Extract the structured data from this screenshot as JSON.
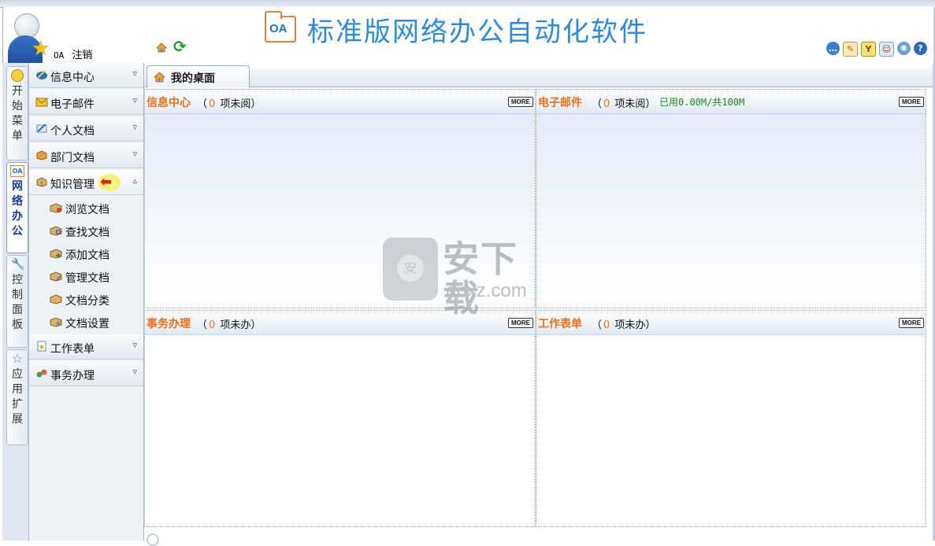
{
  "header": {
    "title": "标准版网络办公自动化软件",
    "logo_text": "OA",
    "user": {
      "name": "OA",
      "logout_label": "注销"
    },
    "right_icons": [
      "chat-icon",
      "edit-icon",
      "yen-icon",
      "contacts-icon",
      "settings-icon",
      "help-icon"
    ]
  },
  "vertical_tabs": [
    {
      "label": "开始菜单",
      "icon": "bulb-icon"
    },
    {
      "label": "网络办公",
      "icon": "oa-icon",
      "active": true
    },
    {
      "label": "控制面板",
      "icon": "wrench-icon"
    },
    {
      "label": "应用扩展",
      "icon": "star-icon"
    }
  ],
  "sidebar": {
    "menus": [
      {
        "label": "信息中心",
        "icon": "info-center-icon",
        "expanded": false
      },
      {
        "label": "电子邮件",
        "icon": "email-icon",
        "expanded": false
      },
      {
        "label": "个人文档",
        "icon": "personal-doc-icon",
        "expanded": false
      },
      {
        "label": "部门文档",
        "icon": "dept-doc-icon",
        "expanded": false
      },
      {
        "label": "知识管理",
        "icon": "knowledge-icon",
        "expanded": true
      },
      {
        "label": "工作表单",
        "icon": "work-form-icon",
        "expanded": false
      },
      {
        "label": "事务办理",
        "icon": "affairs-icon",
        "expanded": false
      }
    ],
    "knowledge_items": [
      {
        "label": "浏览文档",
        "icon": "browse-doc-icon"
      },
      {
        "label": "查找文档",
        "icon": "find-doc-icon"
      },
      {
        "label": "添加文档",
        "icon": "add-doc-icon"
      },
      {
        "label": "管理文档",
        "icon": "manage-doc-icon"
      },
      {
        "label": "文档分类",
        "icon": "doc-category-icon"
      },
      {
        "label": "文档设置",
        "icon": "doc-settings-icon"
      }
    ]
  },
  "tabs": [
    {
      "label": "我的桌面",
      "icon": "desktop-icon"
    }
  ],
  "panels": {
    "info": {
      "title": "信息中心",
      "count_prefix": "（",
      "count": "0",
      "count_suffix": " 项未阅）",
      "more": "MORE"
    },
    "email": {
      "title": "电子邮件",
      "count_prefix": "（",
      "count": "0",
      "count_suffix": " 项未阅）",
      "quota": "已用0.00M/共100M",
      "more": "MORE"
    },
    "affairs": {
      "title": "事务办理",
      "count_prefix": "（",
      "count": "0",
      "count_suffix": " 项未办）",
      "more": "MORE"
    },
    "forms": {
      "title": "工作表单",
      "count_prefix": "（",
      "count": "0",
      "count_suffix": " 项未办）",
      "more": "MORE"
    }
  },
  "watermark": {
    "cn": "安下载",
    "en": "anxz.com"
  },
  "colors": {
    "accent_orange": "#e8711a",
    "title_blue": "#2f8ad8",
    "quota_green": "#1a8a1a"
  }
}
